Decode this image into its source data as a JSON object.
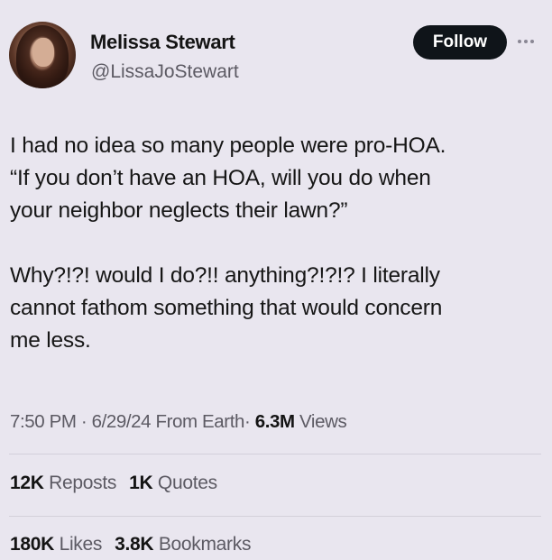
{
  "author": {
    "name": "Melissa Stewart",
    "handle": "@LissaJoStewart",
    "avatar_icon": "profile-photo"
  },
  "follow_label": "Follow",
  "more_icon": "ellipsis-icon",
  "tweet": {
    "paragraph1": "I had no idea so many people were pro-HOA.\n“If you don’t have an HOA, will you do when\nyour neighbor neglects their lawn?”",
    "paragraph2": "Why?!?! would I do?!! anything?!?!? I literally\ncannot fathom something that would concern\nme less."
  },
  "meta": {
    "time": "7:50 PM",
    "sep1": "·",
    "date": "6/29/24",
    "source": "From Earth",
    "sep2": "·",
    "views_count": "6.3M",
    "views_label": "Views"
  },
  "stats_row1": {
    "reposts_count": "12K",
    "reposts_label": "Reposts",
    "quotes_count": "1K",
    "quotes_label": "Quotes"
  },
  "stats_row2": {
    "likes_count": "180K",
    "likes_label": "Likes",
    "bookmarks_count": "3.8K",
    "bookmarks_label": "Bookmarks"
  }
}
